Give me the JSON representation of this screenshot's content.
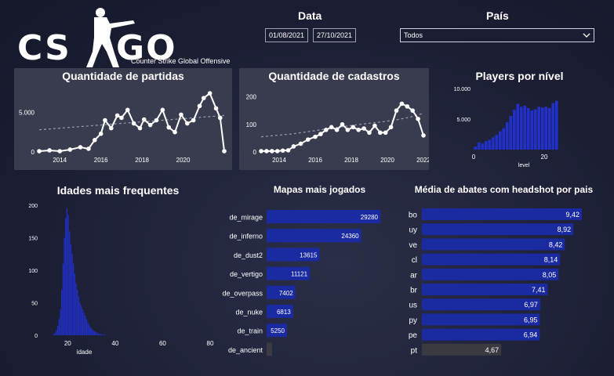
{
  "logo": {
    "text_left": "CS",
    "text_right": "GO",
    "subtitle": "Counter Strike Global Offensive"
  },
  "filters": {
    "date_label": "Data",
    "date_start": "01/08/2021",
    "date_end": "27/10/2021",
    "country_label": "País",
    "country_value": "Todos"
  },
  "colors": {
    "bar": "#1a2aa0",
    "bar_bright": "#2030c8",
    "line": "#ffffff",
    "panel": "#3a3d50",
    "bar_dark": "#3a3a40"
  },
  "chart_data": [
    {
      "id": "partidas",
      "type": "line",
      "title": "Quantidade de partidas",
      "x_ticks": [
        "2014",
        "2016",
        "2018",
        "2020"
      ],
      "y_ticks": [
        "0",
        "5.000"
      ],
      "ylim": [
        0,
        8000
      ],
      "x": [
        2013.0,
        2013.5,
        2014.0,
        2014.5,
        2015.0,
        2015.4,
        2015.7,
        2016.0,
        2016.2,
        2016.5,
        2016.8,
        2017.0,
        2017.3,
        2017.6,
        2017.9,
        2018.1,
        2018.4,
        2018.7,
        2019.0,
        2019.3,
        2019.6,
        2019.9,
        2020.2,
        2020.5,
        2020.8,
        2021.0,
        2021.3,
        2021.6,
        2021.8,
        2022.0
      ],
      "y": [
        100,
        200,
        100,
        300,
        600,
        400,
        1500,
        2300,
        4000,
        3000,
        4600,
        4300,
        5300,
        3600,
        3000,
        4100,
        3400,
        4000,
        5300,
        3100,
        2500,
        4700,
        3600,
        4000,
        5800,
        6800,
        7400,
        5500,
        4300,
        100
      ],
      "trend": [
        2800,
        3000,
        3200,
        3400,
        3600,
        3800,
        4000,
        4200,
        4400,
        4600
      ]
    },
    {
      "id": "cadastros",
      "type": "line",
      "title": "Quantidade de cadastros",
      "x_ticks": [
        "2014",
        "2016",
        "2018",
        "2020",
        "2022"
      ],
      "y_ticks": [
        "0",
        "100",
        "200"
      ],
      "ylim": [
        0,
        230
      ],
      "x": [
        2013.0,
        2013.3,
        2013.6,
        2013.9,
        2014.2,
        2014.5,
        2014.8,
        2015.2,
        2015.6,
        2016.0,
        2016.3,
        2016.6,
        2016.9,
        2017.2,
        2017.5,
        2017.8,
        2018.1,
        2018.4,
        2018.7,
        2019.0,
        2019.3,
        2019.6,
        2019.9,
        2020.2,
        2020.5,
        2020.8,
        2021.1,
        2021.4,
        2021.7,
        2022.0
      ],
      "y": [
        3,
        3,
        3,
        3,
        5,
        6,
        20,
        30,
        45,
        55,
        65,
        80,
        90,
        80,
        100,
        80,
        90,
        80,
        85,
        70,
        95,
        70,
        70,
        90,
        150,
        175,
        165,
        150,
        120,
        60
      ],
      "trend": [
        55,
        60,
        65,
        72,
        80,
        88,
        95,
        102,
        108,
        115,
        125,
        140
      ]
    },
    {
      "id": "nivel",
      "type": "bar",
      "title": "Players por nível",
      "xlabel": "level",
      "x_ticks": [
        "0",
        "20"
      ],
      "y_ticks": [
        "5.000",
        "10.000"
      ],
      "ylim": [
        0,
        10000
      ],
      "values": [
        500,
        1200,
        1000,
        1400,
        1600,
        2000,
        2400,
        3000,
        3500,
        4500,
        5500,
        6500,
        7500,
        7000,
        7200,
        6800,
        6400,
        6600,
        7000,
        6900,
        7000,
        6800,
        7600,
        8000
      ]
    },
    {
      "id": "idades",
      "type": "bar",
      "title": "Idades mais frequentes",
      "xlabel": "idade",
      "x_ticks": [
        "20",
        "40",
        "60",
        "80"
      ],
      "y_ticks": [
        "0",
        "50",
        "100",
        "150",
        "200"
      ],
      "ylim": [
        0,
        200
      ],
      "x_range": [
        10,
        80
      ],
      "values": [
        2,
        4,
        8,
        15,
        25,
        40,
        70,
        110,
        150,
        180,
        195,
        185,
        160,
        140,
        125,
        110,
        95,
        80,
        70,
        60,
        50,
        45,
        40,
        35,
        30,
        25,
        20,
        16,
        12,
        10,
        8,
        6,
        5,
        4,
        3,
        2,
        2,
        1,
        1,
        1
      ]
    },
    {
      "id": "mapas",
      "type": "bar",
      "title": "Mapas mais jogados",
      "categories": [
        "de_mirage",
        "de_inferno",
        "de_dust2",
        "de_vertigo",
        "de_overpass",
        "de_nuke",
        "de_train",
        "de_ancient"
      ],
      "values": [
        29280,
        24360,
        13615,
        11121,
        7402,
        6813,
        5250,
        0
      ],
      "labels": [
        "29280",
        "24360",
        "13615",
        "11121",
        "7402",
        "6813",
        "5250",
        ""
      ],
      "max": 29280
    },
    {
      "id": "headshot",
      "type": "bar",
      "title": "Média de abates com headshot por pais",
      "categories": [
        "bo",
        "uy",
        "ve",
        "cl",
        "ar",
        "br",
        "us",
        "py",
        "pe",
        "pt"
      ],
      "values": [
        9.42,
        8.92,
        8.42,
        8.14,
        8.05,
        7.41,
        6.97,
        6.95,
        6.94,
        4.67
      ],
      "labels": [
        "9,42",
        "8,92",
        "8,42",
        "8,14",
        "8,05",
        "7,41",
        "6,97",
        "6,95",
        "6,94",
        "4,67"
      ],
      "max": 9.42
    }
  ]
}
